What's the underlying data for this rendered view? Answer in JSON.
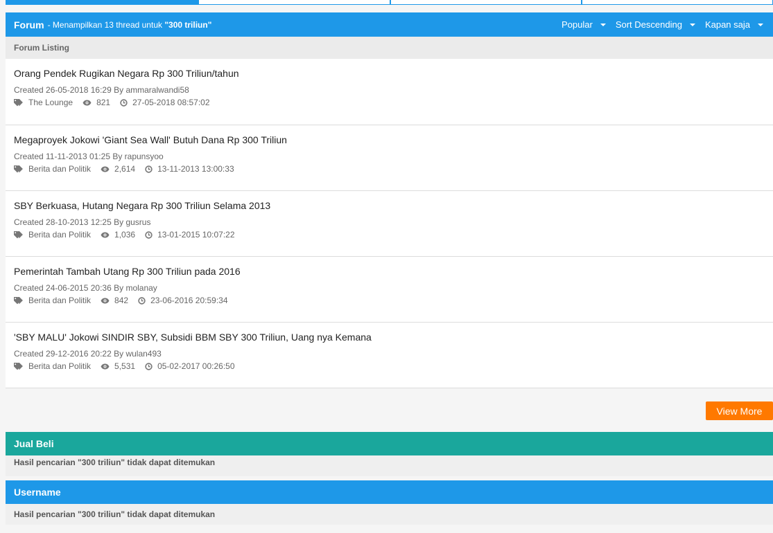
{
  "forum": {
    "title": "Forum",
    "description_prefix": "- Menampilkan 13 thread untuk",
    "query": "\"300 triliun\"",
    "filters": [
      "Popular",
      "Sort Descending",
      "Kapan saja"
    ],
    "listing_label": "Forum Listing",
    "threads": [
      {
        "title": "Orang Pendek Rugikan Negara Rp 300 Triliun/tahun",
        "created": "Created 26-05-2018 16:29 By ammaralwandi58",
        "category": "The Lounge",
        "views": "821",
        "last": "27-05-2018 08:57:02"
      },
      {
        "title": "Megaproyek Jokowi 'Giant Sea Wall' Butuh Dana Rp 300 Triliun",
        "created": "Created 11-11-2013 01:25 By rapunsyoo",
        "category": "Berita dan Politik",
        "views": "2,614",
        "last": "13-11-2013 13:00:33"
      },
      {
        "title": "SBY Berkuasa, Hutang Negara Rp 300 Triliun Selama 2013",
        "created": "Created 28-10-2013 12:25 By gusrus",
        "category": "Berita dan Politik",
        "views": "1,036",
        "last": "13-01-2015 10:07:22"
      },
      {
        "title": "Pemerintah Tambah Utang Rp 300 Triliun pada 2016",
        "created": "Created 24-06-2015 20:36 By molanay",
        "category": "Berita dan Politik",
        "views": "842",
        "last": "23-06-2016 20:59:34"
      },
      {
        "title": "'SBY MALU' Jokowi SINDIR SBY, Subsidi BBM SBY 300 Triliun, Uang nya Kemana",
        "created": "Created 29-12-2016 20:22 By wulan493",
        "category": "Berita dan Politik",
        "views": "5,531",
        "last": "05-02-2017 00:26:50"
      }
    ],
    "view_more": "View More"
  },
  "jual_beli": {
    "title": "Jual Beli",
    "message": "Hasil pencarian \"300 triliun\" tidak dapat ditemukan"
  },
  "username": {
    "title": "Username",
    "message": "Hasil pencarian \"300 triliun\" tidak dapat ditemukan"
  },
  "icons": {
    "category": "tags-icon",
    "views": "eye-icon",
    "last_post": "clock-icon"
  },
  "colors": {
    "primary": "#1e98e8",
    "jual_beli": "#1aa79c",
    "view_more": "#ff7900"
  }
}
